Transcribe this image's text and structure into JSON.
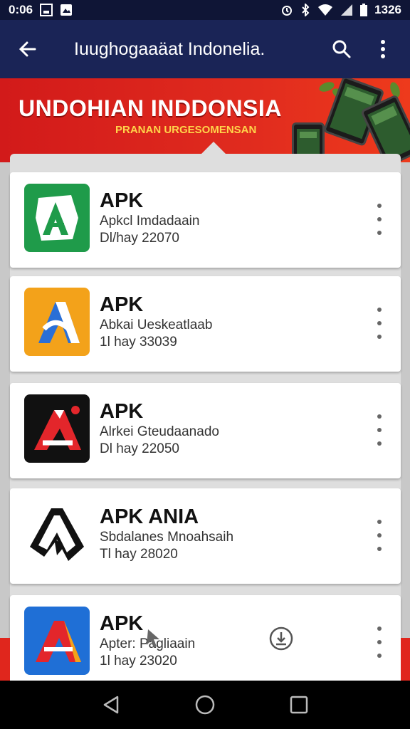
{
  "status_bar": {
    "time": "0:06",
    "battery": "1326",
    "icons": [
      "image-icon",
      "notification-icon",
      "alarm-icon",
      "bluetooth-icon",
      "wifi-icon",
      "signal-icon",
      "battery-icon"
    ]
  },
  "app_bar": {
    "title": "Iuughogaaäat Indonelia.",
    "back_icon": "arrow-back-icon",
    "search_icon": "search-icon",
    "menu_icon": "more-vert-icon"
  },
  "banner": {
    "title": "UNDOHIAN INDDONSIA",
    "subtitle": "PRANAN URGESOMENSAN"
  },
  "apps": [
    {
      "name": "APK",
      "subtitle": "Apkcl Imdadaain",
      "date": "Dl/hay 22070",
      "icon": "apk-green-icon",
      "color": "#1f9b4a"
    },
    {
      "name": "APK",
      "subtitle": "Abkai Ueskeatlaab",
      "date": "1l hay 33039",
      "icon": "apk-orange-icon",
      "color": "#f3a21a"
    },
    {
      "name": "APK",
      "subtitle": "Alrkei Gteudaanado",
      "date": "Dl hay 22050",
      "icon": "apk-black-red-icon",
      "color": "#111111"
    },
    {
      "name": "APK ANIA",
      "subtitle": "Sbdalanes Mnoahsaih",
      "date": "Tl hay 28020",
      "icon": "apk-outline-icon",
      "color": "#ffffff"
    },
    {
      "name": "APK",
      "subtitle": "Apter: Pagliaain",
      "date": "1l hay 23020",
      "icon": "apk-blue-icon",
      "color": "#1f6fd6"
    }
  ],
  "colors": {
    "app_bar": "#1a2456",
    "status_bar": "#0f1536",
    "banner": "#d21a1a",
    "banner_subtitle": "#ffd44a"
  },
  "nav_bar": {
    "back": "nav-back-icon",
    "home": "nav-home-icon",
    "recents": "nav-recents-icon"
  }
}
